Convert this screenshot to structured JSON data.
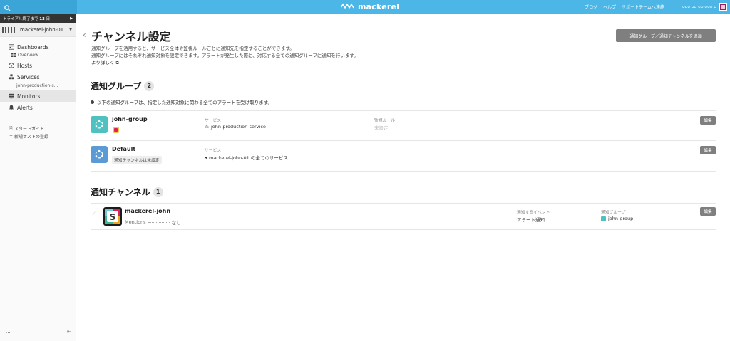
{
  "topbar": {
    "brand": "mackerel",
    "links": [
      "ブログ",
      "ヘルプ",
      "サポートチームへ連絡"
    ],
    "user_name": "ᴗᴗᴗ ᴗᴗ ᴗᴗ ᴗᴗᴗ ᴗ",
    "accent_color": "#4cb7e6"
  },
  "sidebar": {
    "trial_prefix": "トライアル終了まで",
    "trial_days": "13",
    "trial_suffix": "日",
    "org_name": "mackerel-john-01",
    "nav": {
      "dashboards": "Dashboards",
      "overview": "Overview",
      "hosts": "Hosts",
      "services": "Services",
      "service_item": "john-production-s...",
      "monitors": "Monitors",
      "alerts": "Alerts"
    },
    "start_guide": "スタートガイド",
    "new_host": "新規ホストの登録",
    "bottom_left": "...",
    "bottom_right": "⇤"
  },
  "main": {
    "title": "チャンネル設定",
    "add_button": "通知グループ／通知チャンネルを追加",
    "desc_lines": [
      "通知グループを活用すると、サービス全体や監視ルールごとに通知先を指定することができます。",
      "通知グループにはそれぞれ通知対象を設定できます。アラートが発生した際に、対応する全ての通知グループに通知を行います。"
    ],
    "more_link": "より詳しく",
    "groups_title": "通知グループ",
    "groups_count": "2",
    "groups_note": "以下の通知グループは、指定した通知対象に関わる全てのアラートを受け取ります。",
    "groups": [
      {
        "name": "john-group",
        "service_label": "サービス",
        "service_value": "john-production-service",
        "rule_label": "監視ルール",
        "rule_value": "未設定",
        "edit": "編集",
        "icon_color": "#4fc1c1"
      },
      {
        "name": "Default",
        "badge": "通知チャンネルは未設定",
        "service_label": "サービス",
        "service_value": "mackerel-john-01 の全てのサービス",
        "edit": "編集",
        "icon_color": "#5b9bd5"
      }
    ],
    "channels_title": "通知チャンネル",
    "channels_count": "1",
    "channels": [
      {
        "name": "mackerel-john",
        "mentions_label": "Mentions",
        "mentions_value": "なし",
        "event_label": "通知するイベント",
        "event_value": "アラート通知",
        "group_label": "通知グループ",
        "group_value": "john-group",
        "edit": "編集"
      }
    ]
  }
}
